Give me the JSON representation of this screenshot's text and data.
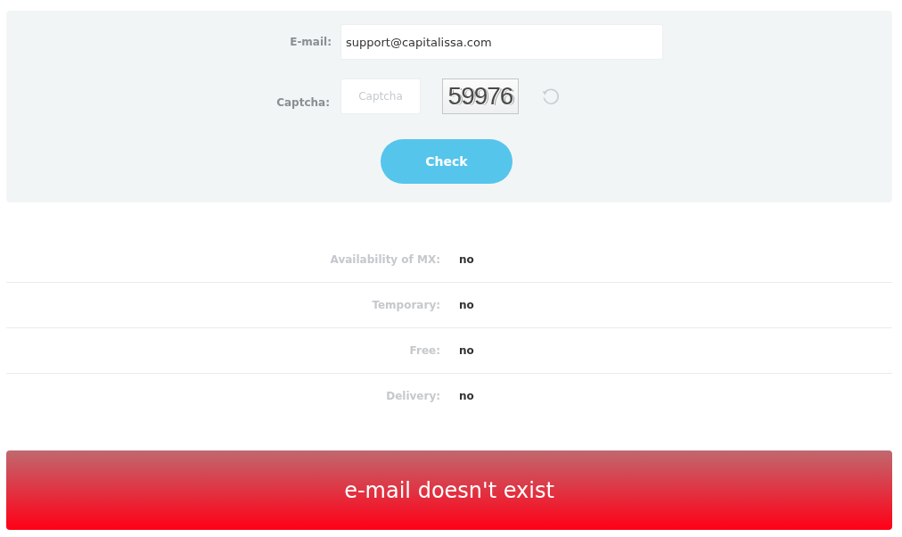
{
  "form": {
    "email": {
      "label": "E-mail:",
      "value": "support@capitalissa.com"
    },
    "captcha": {
      "label": "Captcha:",
      "placeholder": "Captcha",
      "code": "59976"
    },
    "button": "Check"
  },
  "results": [
    {
      "label": "Availability of MX:",
      "value": "no"
    },
    {
      "label": "Temporary:",
      "value": "no"
    },
    {
      "label": "Free:",
      "value": "no"
    },
    {
      "label": "Delivery:",
      "value": "no"
    }
  ],
  "banner": {
    "text": "e-mail doesn't exist",
    "kind": "error"
  }
}
